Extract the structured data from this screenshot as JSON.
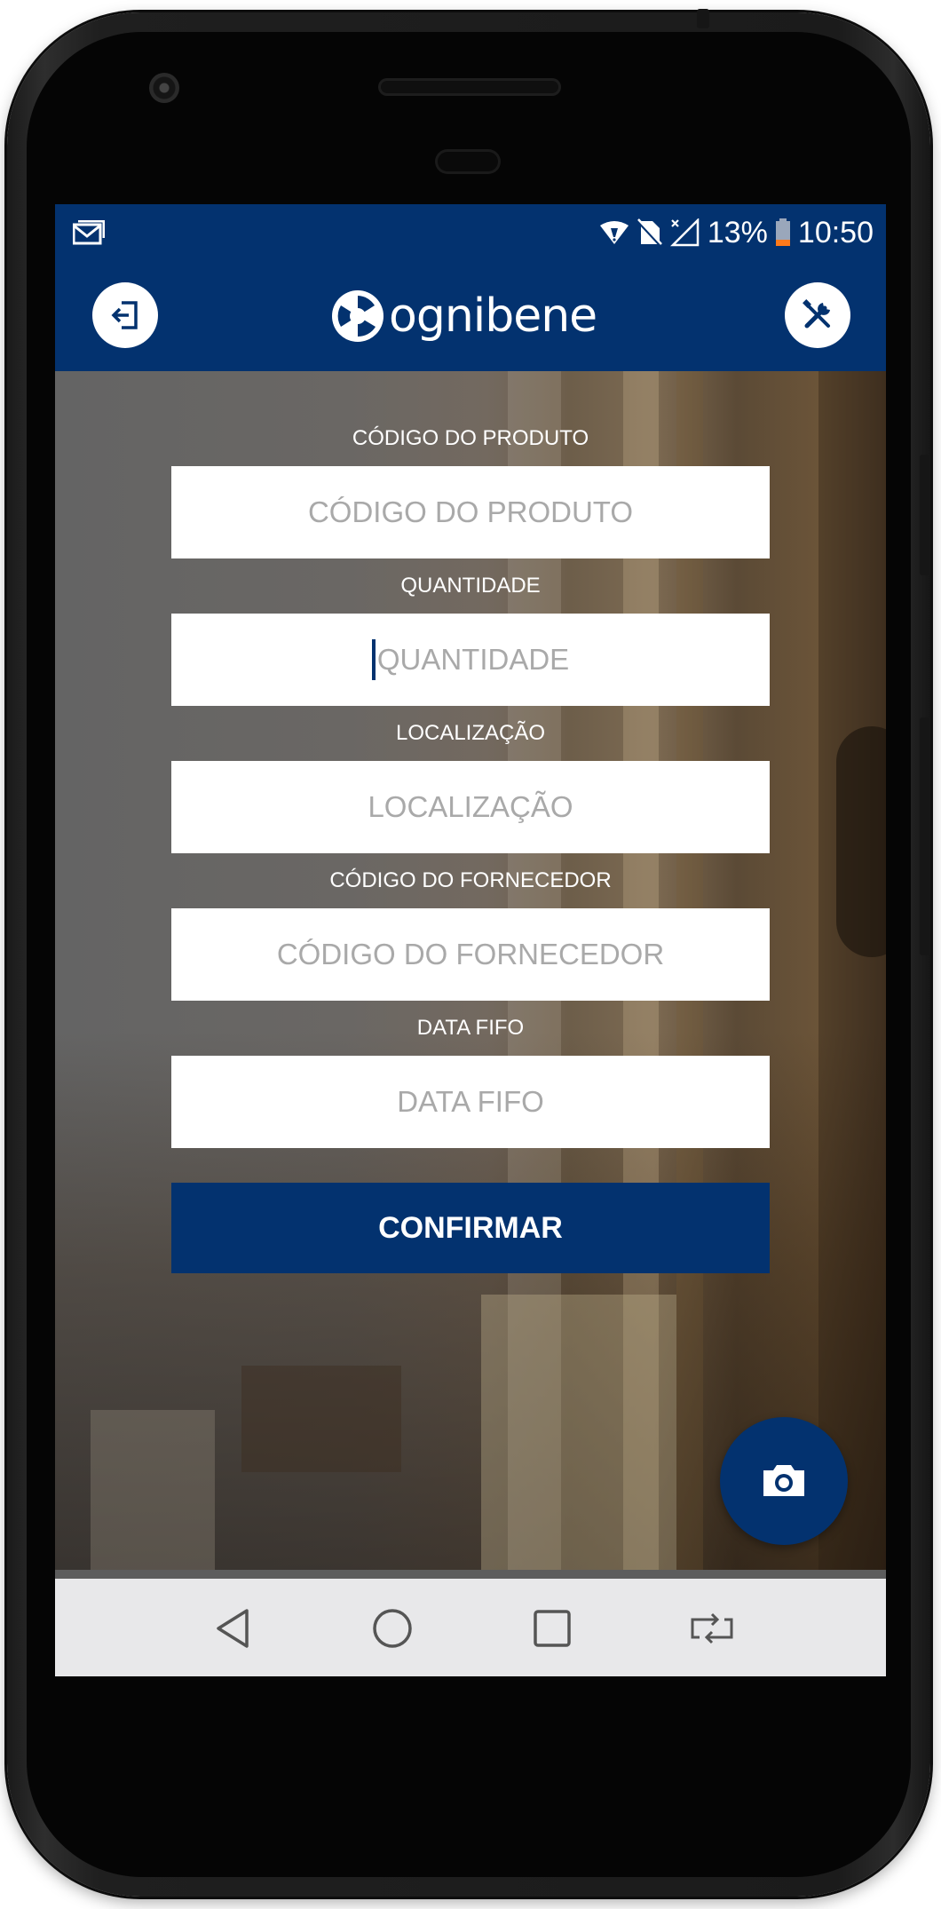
{
  "status_bar": {
    "battery_percent": "13%",
    "time": "10:50",
    "icons": [
      "gmail-notification-icon",
      "wifi-icon",
      "no-sim-icon",
      "signal-icon",
      "battery-icon"
    ]
  },
  "app_bar": {
    "logo_text": "ognibene",
    "left_button_icon": "logout-icon",
    "right_button_icon": "tools-icon",
    "brand_color": "#03326f"
  },
  "form": {
    "fields": [
      {
        "label": "CÓDIGO DO PRODUTO",
        "placeholder": "CÓDIGO DO PRODUTO",
        "value": ""
      },
      {
        "label": "QUANTIDADE",
        "placeholder": "QUANTIDADE",
        "value": "",
        "focused": true
      },
      {
        "label": "LOCALIZAÇÃO",
        "placeholder": "LOCALIZAÇÃO",
        "value": ""
      },
      {
        "label": "CÓDIGO DO FORNECEDOR",
        "placeholder": "CÓDIGO DO FORNECEDOR",
        "value": ""
      },
      {
        "label": "DATA FIFO",
        "placeholder": "DATA FIFO",
        "value": ""
      }
    ],
    "confirm_label": "CONFIRMAR"
  },
  "fab_icon": "camera-icon",
  "nav_bar": {
    "icons": [
      "back-icon",
      "home-icon",
      "recents-icon",
      "rotate-icon"
    ]
  }
}
